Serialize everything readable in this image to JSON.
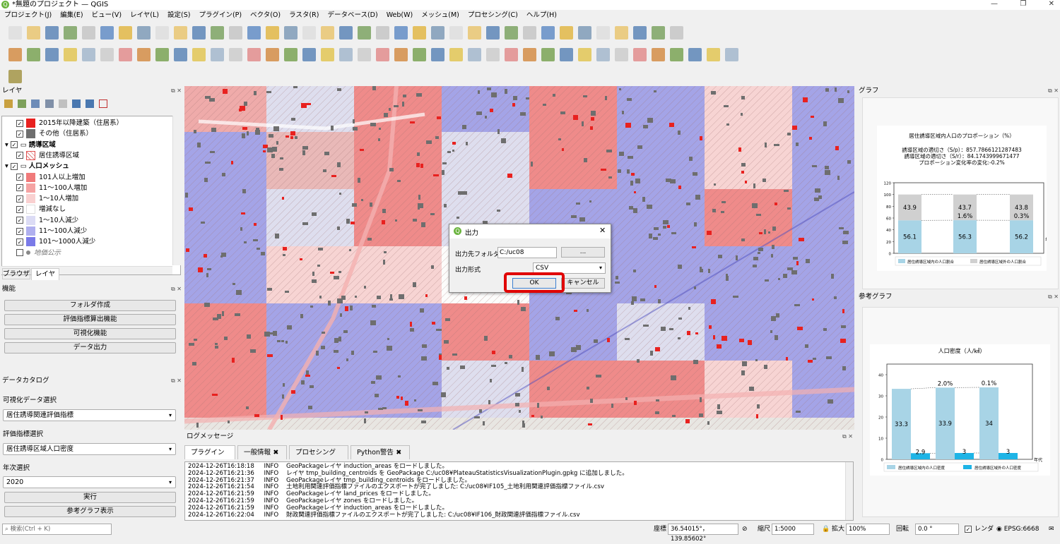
{
  "window": {
    "title": "*無題のプロジェクト — QGIS",
    "controls": [
      "—",
      "❐",
      "✕"
    ]
  },
  "menu": [
    "プロジェクト(J)",
    "編集(E)",
    "ビュー(V)",
    "レイヤ(L)",
    "設定(S)",
    "プラグイン(P)",
    "ベクタ(O)",
    "ラスタ(R)",
    "データベース(D)",
    "Web(W)",
    "メッシュ(M)",
    "プロセシング(C)",
    "ヘルプ(H)"
  ],
  "layers_panel": {
    "title": "レイヤ",
    "items": [
      {
        "label": "2015年以降建築（住居系）",
        "color": "#e8211f"
      },
      {
        "label": "その他（住居系）",
        "color": "#6e6e6e"
      },
      {
        "label": "誘導区域",
        "group": true
      },
      {
        "label": "居住誘導区域",
        "color": "hatch"
      },
      {
        "label": "人口メッシュ",
        "group": true
      },
      {
        "label": "101人以上増加",
        "color": "#f07a7a"
      },
      {
        "label": "11〜100人増加",
        "color": "#f5a3a3"
      },
      {
        "label": "1〜10人増加",
        "color": "#f9d0d0"
      },
      {
        "label": "増減なし",
        "color": "#ffffff"
      },
      {
        "label": "1〜10人減少",
        "color": "#dcdcf5"
      },
      {
        "label": "11〜100人減少",
        "color": "#b0b0ef"
      },
      {
        "label": "101〜1000人減少",
        "color": "#7a7ae8"
      },
      {
        "label": "地価公示",
        "color": "none",
        "muted": true
      }
    ],
    "tabs": [
      "ブラウザ",
      "レイヤ"
    ]
  },
  "functions_panel": {
    "title": "機能",
    "buttons": [
      "フォルダ作成",
      "評価指標算出機能",
      "可視化機能",
      "データ出力"
    ]
  },
  "catalog_panel": {
    "title": "データカタログ",
    "viz_label": "可視化データ選択",
    "viz_value": "居住誘導関連評価指標",
    "eval_label": "評価指標選択",
    "eval_value": "居住誘導区域人口密度",
    "year_label": "年次選択",
    "year_value": "2020",
    "run_button": "実行",
    "ref_button": "参考グラフ表示"
  },
  "dialog": {
    "title": "出力",
    "folder_label": "出力先フォルダ",
    "folder_value": "C:/uc08",
    "browse_button": "...",
    "format_label": "出力形式",
    "format_value": "CSV",
    "ok_button": "OK",
    "cancel_button": "キャンセル",
    "highlight_color": "#e00000"
  },
  "graph_panel": {
    "title": "グラフ",
    "chart_title": "居住誘導区域内人口のプロポーション（%）",
    "line1": "誘導区域の適切さ（S/p）：857.7866121287483",
    "line2": "誘導区域の適切さ（S/r）：84.1743999671477",
    "line3": "プロポーション変化率の変化:-0.2%",
    "x_unit": "年",
    "legend": [
      "居住誘導区域内の人口割合",
      "居住誘導区域外の人口割合"
    ],
    "ticks": [
      "0",
      "20",
      "40",
      "60",
      "80",
      "100",
      "120"
    ]
  },
  "ref_graph_panel": {
    "title": "参考グラフ",
    "chart_title": "人口密度（人/㎢）",
    "x_unit": "年代",
    "legend": [
      "居住誘導区域内の人口密度",
      "居住誘導区域外の人口密度"
    ],
    "ticks": [
      "0",
      "10",
      "20",
      "30",
      "40"
    ]
  },
  "chart_data": [
    {
      "type": "bar",
      "title": "居住誘導区域内人口のプロポーション（%）",
      "ylim": [
        0,
        120
      ],
      "series": [
        {
          "name": "居住誘導区域内の人口割合",
          "values": [
            56.1,
            56.3,
            56.2
          ],
          "color": "#a8d4e6"
        },
        {
          "name": "居住誘導区域外の人口割合",
          "values": [
            43.9,
            43.7,
            43.8
          ],
          "color": "#d0d0d0"
        }
      ],
      "annotations": [
        "1.6%",
        "0.3%"
      ]
    },
    {
      "type": "bar",
      "title": "人口密度（人/㎢）",
      "ylim": [
        0,
        45
      ],
      "series": [
        {
          "name": "居住誘導区域内の人口密度",
          "values": [
            33.3,
            33.9,
            34.0
          ],
          "color": "#a8d4e6"
        },
        {
          "name": "居住誘導区域外の人口密度",
          "values": [
            2.9,
            3.0,
            3.0
          ],
          "color": "#1eb4e6"
        }
      ],
      "annotations": [
        "2.0%",
        "0.1%"
      ]
    }
  ],
  "log_panel": {
    "title": "ログメッセージ",
    "tabs": [
      "プラグイン",
      "一般情報",
      "プロセシング",
      "Python警告"
    ],
    "lines": [
      "2024-12-26T16:18:18     INFO    GeoPackageレイヤ induction_areas をロードしました。",
      "2024-12-26T16:21:36     INFO    レイヤ tmp_building_centroids を GeoPackage C:/uc08¥PlateauStatisticsVisualizationPlugin.gpkg に追加しました。",
      "2024-12-26T16:21:37     INFO    GeoPackageレイヤ tmp_building_centroids をロードしました。",
      "2024-12-26T16:21:54     INFO    土地利用関連評価指標ファイルのエクスポートが完了しました: C:/uc08¥IF105_土地利用関連評価指標ファイル.csv",
      "2024-12-26T16:21:59     INFO    GeoPackageレイヤ land_prices をロードしました。",
      "2024-12-26T16:21:59     INFO    GeoPackageレイヤ zones をロードしました。",
      "2024-12-26T16:21:59     INFO    GeoPackageレイヤ induction_areas をロードしました。",
      "2024-12-26T16:22:04     INFO    財政関連評価指標ファイルのエクスポートが完了しました: C:/uc08¥IF106_財政関連評価指標ファイル.csv"
    ]
  },
  "statusbar": {
    "search_placeholder": "検索(Ctrl + K)",
    "coord_label": "座標",
    "coord_value": "36.54015°，139.85602°",
    "scale_label": "縮尺",
    "scale_value": "1:5000",
    "zoom_label": "拡大",
    "zoom_value": "100%",
    "rotation_label": "回転",
    "rotation_value": "0.0 °",
    "render_label": "レンダ",
    "crs": "EPSG:6668"
  }
}
